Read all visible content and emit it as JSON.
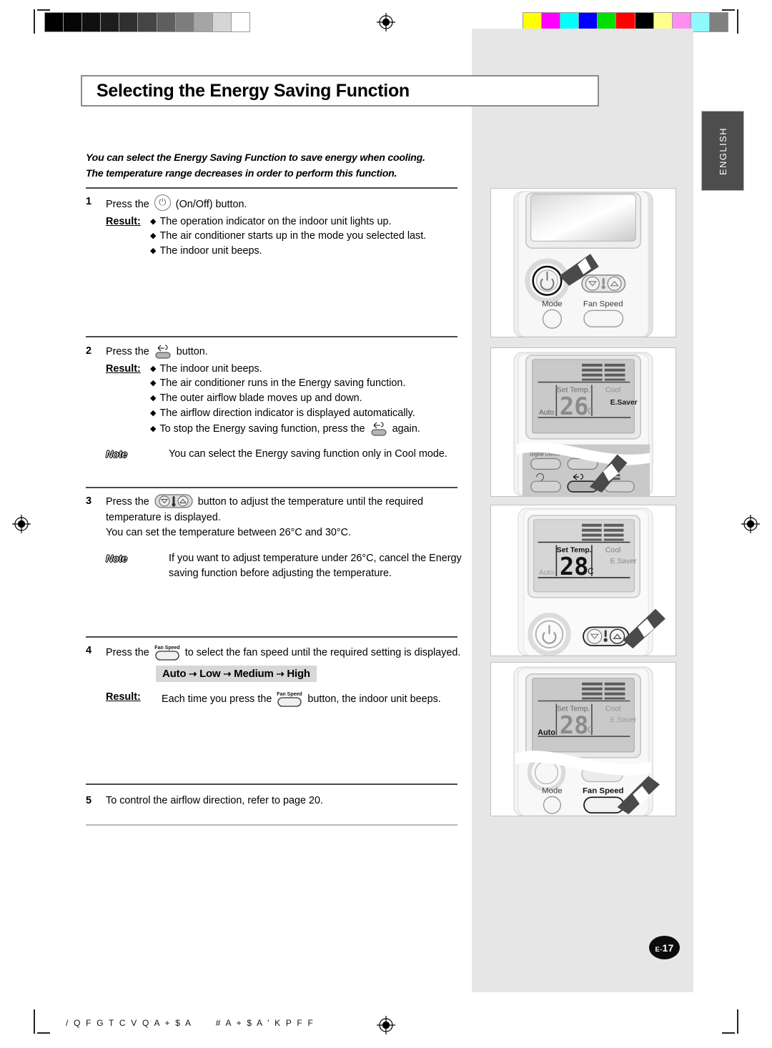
{
  "document": {
    "title": "Selecting the Energy Saving Function",
    "language_tab": "ENGLISH",
    "page_number_prefix": "E-",
    "page_number": "17",
    "footer_text": "/ Q F G T C V Q A + $ A      # A + $ A ' K P F F"
  },
  "intro": {
    "line1": "You can select the Energy Saving Function to save energy when cooling.",
    "line2": "The temperature range decreases in order to perform this function."
  },
  "labels": {
    "result": "Result:",
    "note": "Note",
    "bullet": "◆"
  },
  "steps": [
    {
      "number": "1",
      "text_before_icon": "Press the",
      "icon": "power-on-off-icon",
      "text_after_icon": "(On/Off) button.",
      "result_bullets": [
        "The operation indicator on the indoor unit lights up.",
        "The air conditioner starts up in the mode you selected last.",
        "The indoor unit beeps."
      ]
    },
    {
      "number": "2",
      "text_before_icon": "Press the",
      "icon": "energy-saver-button-icon",
      "text_after_icon": "button.",
      "result_bullets": [
        "The indoor unit beeps.",
        "The air conditioner runs in the Energy saving function.",
        "The outer airflow blade moves up and down.",
        "The airflow direction indicator is displayed automatically."
      ],
      "last_bullet_before_icon": "To stop the Energy saving function, press the",
      "last_bullet_after_icon": "again.",
      "note": "You can select the Energy saving function only in Cool mode."
    },
    {
      "number": "3",
      "text_before_icon": "Press the",
      "icon": "temperature-up-down-button-icon",
      "text_after_icon": "button to adjust the temperature until the required",
      "line2": "temperature is displayed.",
      "line3": "You can set the temperature between 26°C and 30°C.",
      "note_line1": "If you want to adjust temperature under 26°C, cancel the Energy",
      "note_line2": "saving function before adjusting the temperature."
    },
    {
      "number": "4",
      "text_before_icon": "Press the",
      "icon": "fan-speed-button-icon",
      "text_after_icon": "to select the fan speed until the required setting is displayed.",
      "sequence": [
        "Auto",
        "Low",
        "Medium",
        "High"
      ],
      "sequence_arrow": "⇢",
      "result_before_icon": "Each time you press the",
      "result_after_icon": "button, the indoor unit beeps."
    },
    {
      "number": "5",
      "text": "To control the airflow direction, refer to page 20."
    }
  ],
  "illustrations": [
    {
      "name": "remote-power-button-panel",
      "labels": {
        "mode": "Mode",
        "fan_speed": "Fan Speed"
      },
      "highlight": "power-button"
    },
    {
      "name": "remote-esaver-button-panel",
      "display": {
        "set_temp": "Set Temp.",
        "value": "26",
        "unit": "C",
        "mode": "Cool",
        "esaver": "E.Saver",
        "fan": "Auto"
      },
      "button_labels": {
        "digital_display": "Digital Dis/Off"
      },
      "highlight": "esaver-button"
    },
    {
      "name": "remote-temp-up-panel",
      "display": {
        "set_temp": "Set Temp.",
        "value": "28",
        "unit": "C",
        "mode": "Cool",
        "esaver": "E.Saver",
        "fan": "Auto"
      },
      "highlight": "temp-up-button"
    },
    {
      "name": "remote-fan-speed-panel",
      "display": {
        "set_temp": "Set Temp.",
        "value": "28",
        "unit": "C",
        "mode": "Cool",
        "esaver": "E.Saver",
        "fan": "Auto"
      },
      "labels": {
        "mode": "Mode",
        "fan_speed": "Fan Speed"
      },
      "highlight": "fan-speed-button"
    }
  ],
  "calibration": {
    "grayscale_steps": [
      "#000000",
      "#060606",
      "#101010",
      "#1d1d1d",
      "#303030",
      "#454545",
      "#5e5e5e",
      "#7d7d7d",
      "#a5a5a5",
      "#d5d5d5",
      "#ffffff"
    ],
    "color_steps": [
      "#ffff00",
      "#ff00ff",
      "#00ffff",
      "#0000ff",
      "#00e000",
      "#ff0000",
      "#000000",
      "#ffff8e",
      "#ff8ef2",
      "#8efaff",
      "#808080"
    ]
  }
}
